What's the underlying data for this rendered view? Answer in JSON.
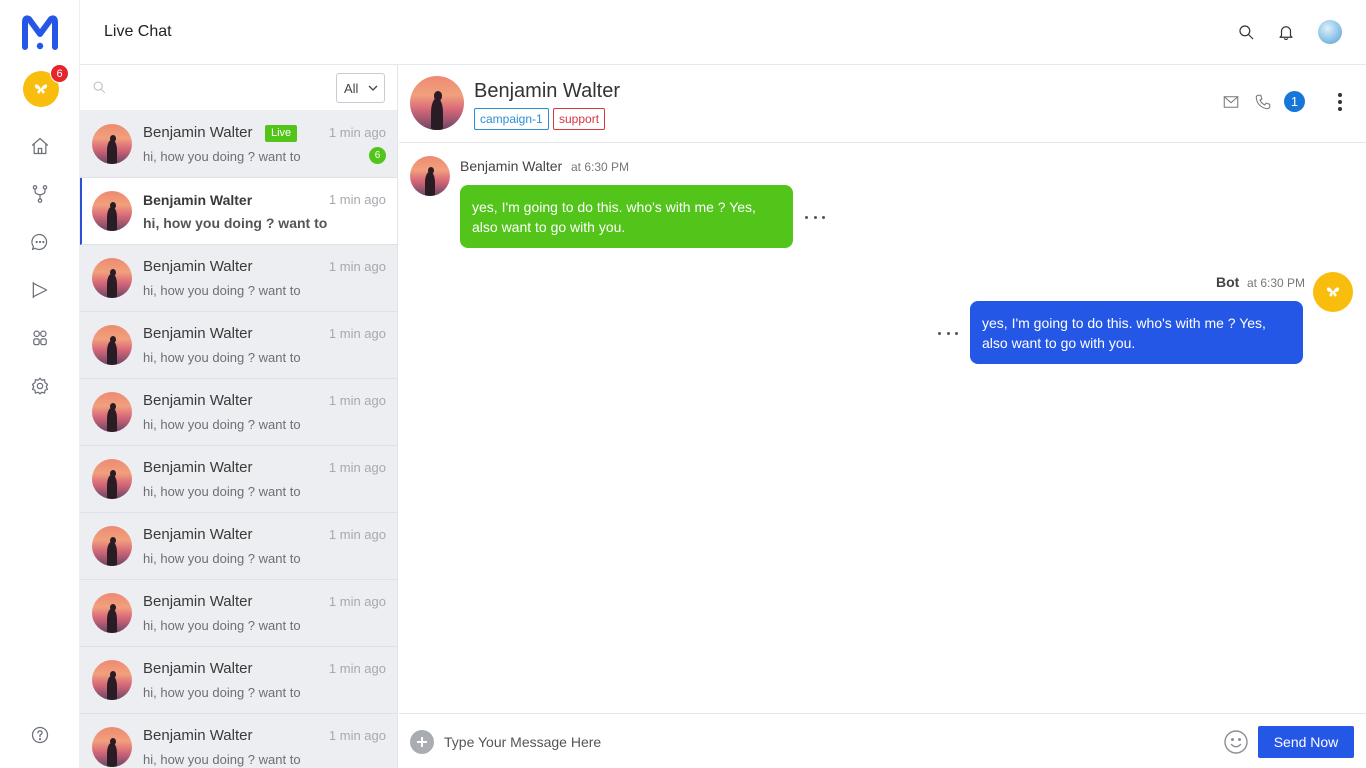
{
  "header": {
    "title": "Live Chat",
    "workspace_badge_count": "6",
    "icons": [
      "search-icon",
      "bell-icon",
      "user-avatar"
    ]
  },
  "sidebar": {
    "items": [
      {
        "icon": "home-icon"
      },
      {
        "icon": "flow-icon"
      },
      {
        "icon": "chat-icon"
      },
      {
        "icon": "campaign-icon"
      },
      {
        "icon": "integrations-icon"
      },
      {
        "icon": "settings-icon"
      }
    ],
    "help_icon": "help-icon"
  },
  "conversation_list": {
    "search_placeholder": "",
    "filter_value": "All",
    "items": [
      {
        "name": "Benjamin Walter",
        "preview": "hi, how you doing ? want to",
        "time": "1 min ago",
        "badge": "Live",
        "unread": "6"
      },
      {
        "name": "Benjamin Walter",
        "preview": "hi, how you doing ? want to",
        "time": "1 min ago"
      },
      {
        "name": "Benjamin Walter",
        "preview": "hi, how you doing ? want to",
        "time": "1 min ago"
      },
      {
        "name": "Benjamin Walter",
        "preview": "hi, how you doing ? want to",
        "time": "1 min ago"
      },
      {
        "name": "Benjamin Walter",
        "preview": "hi, how you doing ? want to",
        "time": "1 min ago"
      },
      {
        "name": "Benjamin Walter",
        "preview": "hi, how you doing ? want to",
        "time": "1 min ago"
      },
      {
        "name": "Benjamin Walter",
        "preview": "hi, how you doing ? want to",
        "time": "1 min ago"
      },
      {
        "name": "Benjamin Walter",
        "preview": "hi, how you doing ? want to",
        "time": "1 min ago"
      },
      {
        "name": "Benjamin Walter",
        "preview": "hi, how you doing ? want to",
        "time": "1 min ago"
      },
      {
        "name": "Benjamin Walter",
        "preview": "hi, how you doing ? want to",
        "time": "1 min ago"
      }
    ]
  },
  "chat": {
    "contact_name": "Benjamin Walter",
    "tags": [
      "campaign-1",
      "support"
    ],
    "info_count": "1",
    "messages": [
      {
        "sender": "Benjamin Walter",
        "time": "at 6:30 PM",
        "text": "yes, I'm going to do this. who's with me ? Yes, also want to go with you."
      },
      {
        "sender": "Bot",
        "time": "at 6:30 PM",
        "text": "yes, I'm going to do this. who's with me ? Yes, also want to go with you."
      }
    ]
  },
  "composer": {
    "placeholder": "Type Your Message Here",
    "send_label": "Send Now"
  },
  "colors": {
    "brand": "#2457e6",
    "live_green": "#52c41a",
    "workspace_yellow": "#f8bd0d",
    "badge_red": "#e5262d"
  }
}
